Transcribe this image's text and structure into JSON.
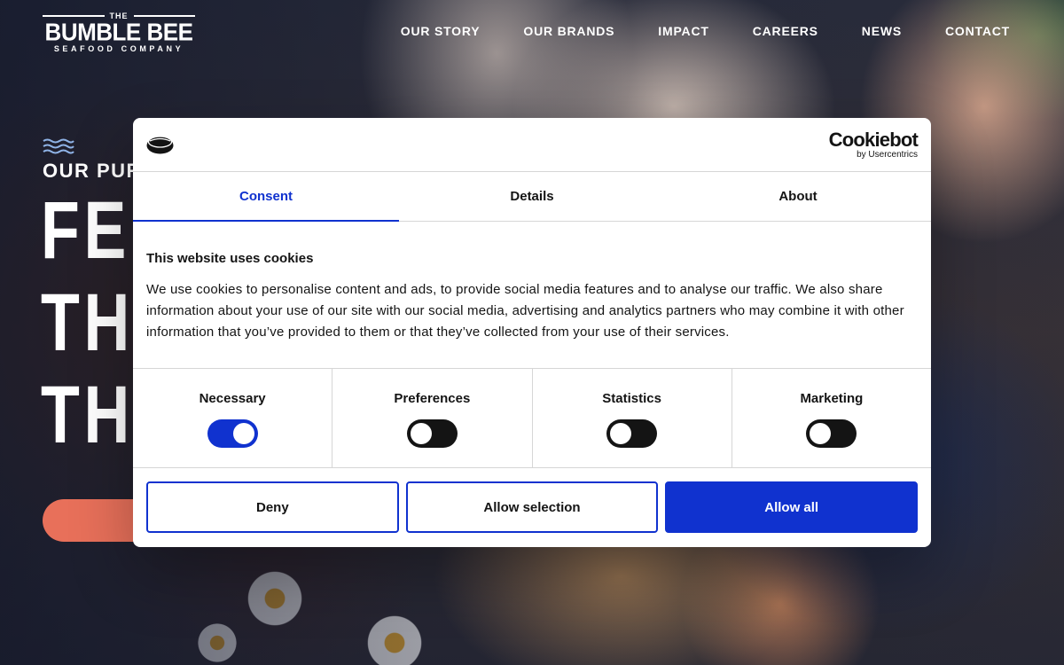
{
  "site": {
    "logo": {
      "top": "THE",
      "main": "BUMBLE BEE",
      "sub": "SEAFOOD COMPANY"
    },
    "nav": [
      {
        "label": "OUR STORY"
      },
      {
        "label": "OUR BRANDS"
      },
      {
        "label": "IMPACT"
      },
      {
        "label": "CAREERS"
      },
      {
        "label": "NEWS"
      },
      {
        "label": "CONTACT"
      }
    ],
    "hero": {
      "eyebrow": "OUR PUR",
      "headline": [
        "FE",
        "TH",
        "TH"
      ],
      "cta_color": "#e8705a"
    }
  },
  "cookie_dialog": {
    "provider": {
      "name": "Cookiebot",
      "by": "by Usercentrics"
    },
    "tabs": [
      {
        "label": "Consent",
        "active": true
      },
      {
        "label": "Details",
        "active": false
      },
      {
        "label": "About",
        "active": false
      }
    ],
    "title": "This website uses cookies",
    "body": "We use cookies to personalise content and ads, to provide social media features and to analyse our traffic. We also share information about your use of our site with our social media, advertising and analytics partners who may combine it with other information that you’ve provided to them or that they’ve collected from your use of their services.",
    "toggles": [
      {
        "label": "Necessary",
        "on": true
      },
      {
        "label": "Preferences",
        "on": false
      },
      {
        "label": "Statistics",
        "on": false
      },
      {
        "label": "Marketing",
        "on": false
      }
    ],
    "buttons": {
      "deny": "Deny",
      "allow_selection": "Allow selection",
      "allow_all": "Allow all"
    },
    "accent_color": "#1032cf"
  }
}
